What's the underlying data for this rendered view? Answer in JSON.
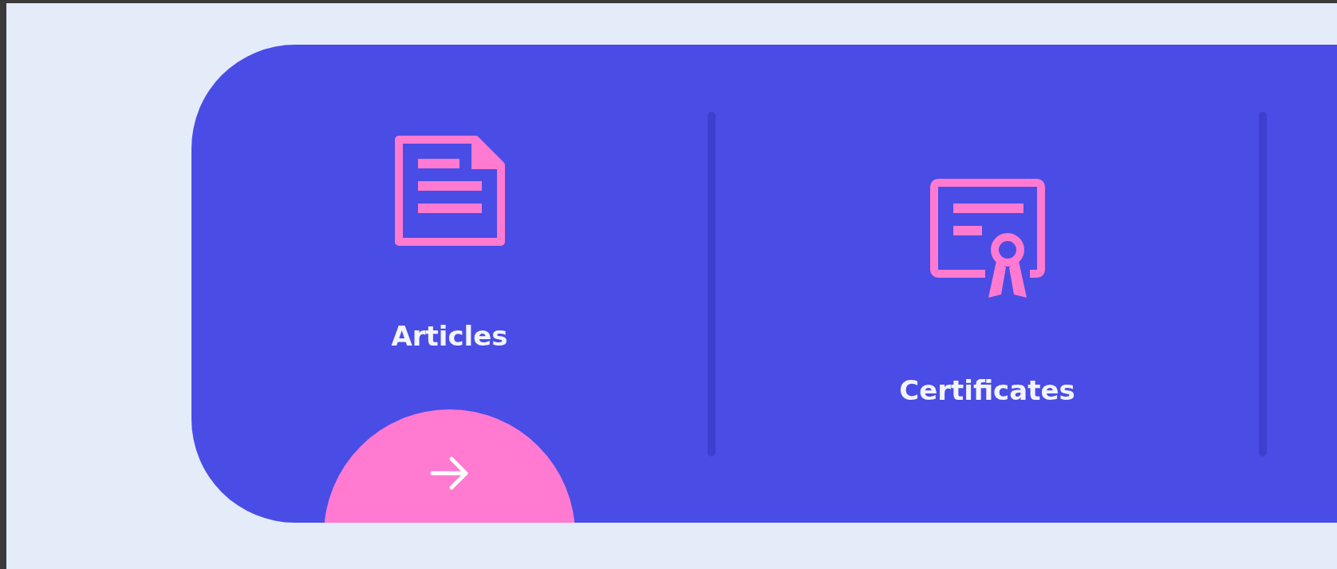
{
  "features": [
    {
      "kind": "article",
      "label": "Articles",
      "action_button": true
    },
    {
      "kind": "certificate",
      "label": "Certificates",
      "action_button": false
    }
  ]
}
